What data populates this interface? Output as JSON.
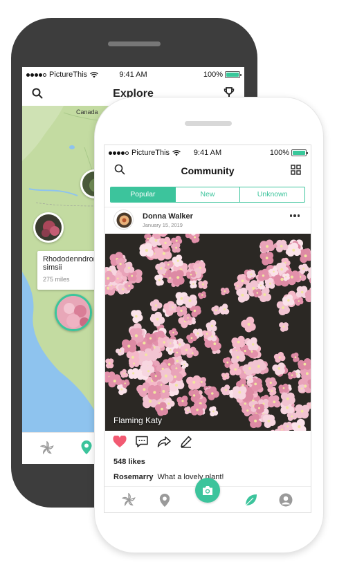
{
  "back_phone": {
    "status": {
      "carrier": "PictureThis",
      "time": "9:41 AM",
      "battery": "100%"
    },
    "header": {
      "title": "Explore"
    },
    "map": {
      "label_canada": "Canada",
      "card": {
        "name": "Rhododenndron simsii",
        "distance": "275 miles"
      }
    }
  },
  "front_phone": {
    "status": {
      "carrier": "PictureThis",
      "time": "9:41 AM",
      "battery": "100%"
    },
    "header": {
      "title": "Community"
    },
    "tabs": [
      {
        "label": "Popular",
        "active": true
      },
      {
        "label": "New",
        "active": false
      },
      {
        "label": "Unknown",
        "active": false
      }
    ],
    "post": {
      "user": "Donna Walker",
      "date": "January 15, 2019",
      "caption": "Flaming Katy",
      "likes": "548 likes",
      "comment": {
        "user": "Rosemarry",
        "text": "What a lovely plant!"
      },
      "liked": true
    }
  },
  "colors": {
    "accent": "#3cc49c",
    "like": "#f25a72",
    "back_phone_frame": "#3d3d3d"
  },
  "icons": [
    "search-icon",
    "trophy-icon",
    "grid-icon",
    "more-icon",
    "heart-icon",
    "comment-icon",
    "share-icon",
    "pencil-icon",
    "flower-icon",
    "location-icon",
    "camera-icon",
    "leaf-icon",
    "profile-icon",
    "wifi-icon"
  ]
}
